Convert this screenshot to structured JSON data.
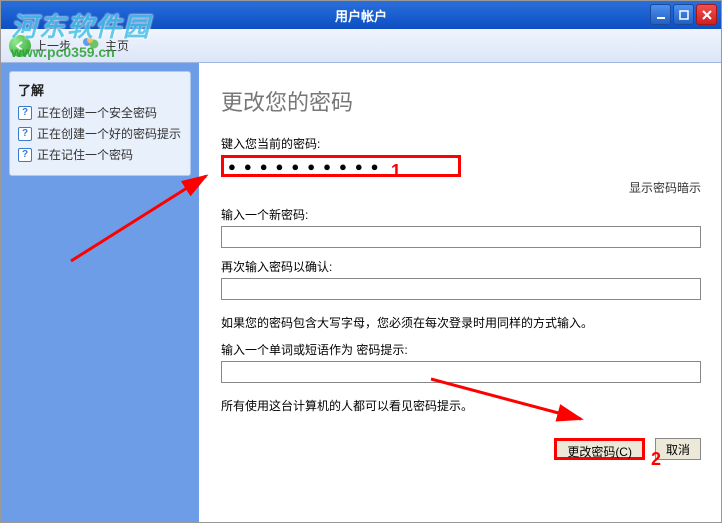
{
  "titlebar": {
    "title": "用户帐户"
  },
  "toolbar": {
    "back": "上一步",
    "home": "主页"
  },
  "watermark": {
    "title": "河东软件园",
    "url": "www.pc0359.cn"
  },
  "sidebar": {
    "heading": "了解",
    "links": [
      "正在创建一个安全密码",
      "正在创建一个好的密码提示",
      "正在记住一个密码"
    ]
  },
  "main": {
    "heading": "更改您的密码",
    "label_current": "键入您当前的密码:",
    "current_value": "●●●●●●●●●●",
    "hint_link": "显示密码暗示",
    "label_new": "输入一个新密码:",
    "label_confirm": "再次输入密码以确认:",
    "caption_caps": "如果您的密码包含大写字母，您必须在每次登录时用同样的方式输入。",
    "label_hint": "输入一个单词或短语作为 密码提示:",
    "caption_visible": "所有使用这台计算机的人都可以看见密码提示。",
    "btn_change": "更改密码(C)",
    "btn_cancel": "取消"
  },
  "anno": {
    "n1": "1",
    "n2": "2"
  }
}
